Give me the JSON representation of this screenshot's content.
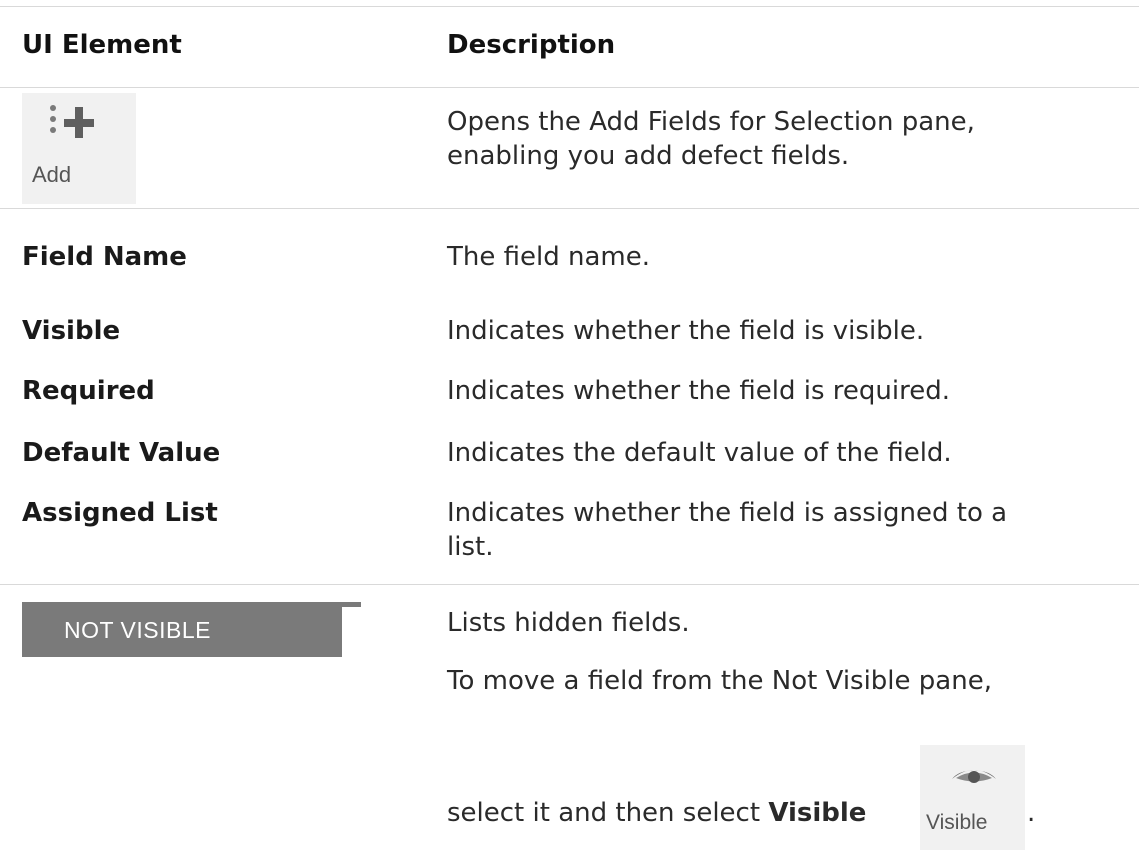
{
  "table": {
    "headers": {
      "element": "UI Element",
      "description": "Description"
    },
    "add_row": {
      "button_label": "Add",
      "description": "Opens the Add Fields for Selection pane, enabling you add defect fields."
    },
    "rows": [
      {
        "element": "Field Name",
        "description": "The field name."
      },
      {
        "element": "Visible",
        "description": "Indicates whether the field is visible."
      },
      {
        "element": "Required",
        "description": "Indicates whether the field is required."
      },
      {
        "element": "Default Value",
        "description": "Indicates the default value of the field."
      },
      {
        "element": "Assigned List",
        "description": "Indicates whether the field is assigned to a list."
      }
    ],
    "not_visible_row": {
      "bar_label": "NOT VISIBLE",
      "line1": "Lists hidden fields.",
      "line2": "To move a field from the Not Visible pane,",
      "line3_prefix": "select it and then select ",
      "line3_bold": "Visible",
      "visible_button_label": "Visible",
      "line3_suffix": "."
    }
  }
}
